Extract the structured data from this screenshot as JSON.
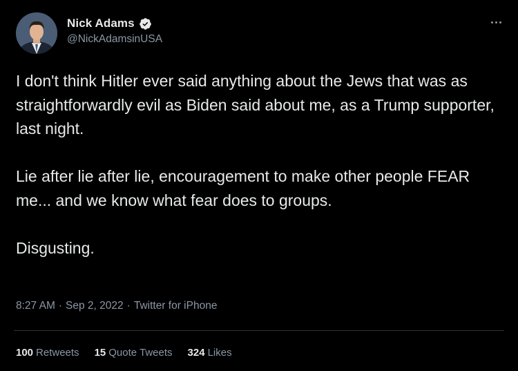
{
  "author": {
    "display_name": "Nick Adams",
    "handle": "@NickAdamsinUSA",
    "verified": true
  },
  "tweet": {
    "paragraphs": [
      "I don't think Hitler ever said anything about the Jews that was as straightforwardly evil as Biden said about me, as a Trump supporter, last night.",
      "Lie after lie after lie, encouragement to make other people FEAR me... and we know what fear does to groups.",
      "Disgusting."
    ],
    "time": "8:27 AM",
    "date": "Sep 2, 2022",
    "source": "Twitter for iPhone"
  },
  "stats": {
    "retweets_count": "100",
    "retweets_label": "Retweets",
    "quotes_count": "15",
    "quotes_label": "Quote Tweets",
    "likes_count": "324",
    "likes_label": "Likes"
  },
  "icons": {
    "verified": "verified-badge-icon",
    "more": "more-options-icon"
  },
  "colors": {
    "background": "#000000",
    "text_primary": "#e7e9ea",
    "text_secondary": "#8b98a5",
    "verified": "#1d9bf0",
    "divider": "#2f3336"
  }
}
